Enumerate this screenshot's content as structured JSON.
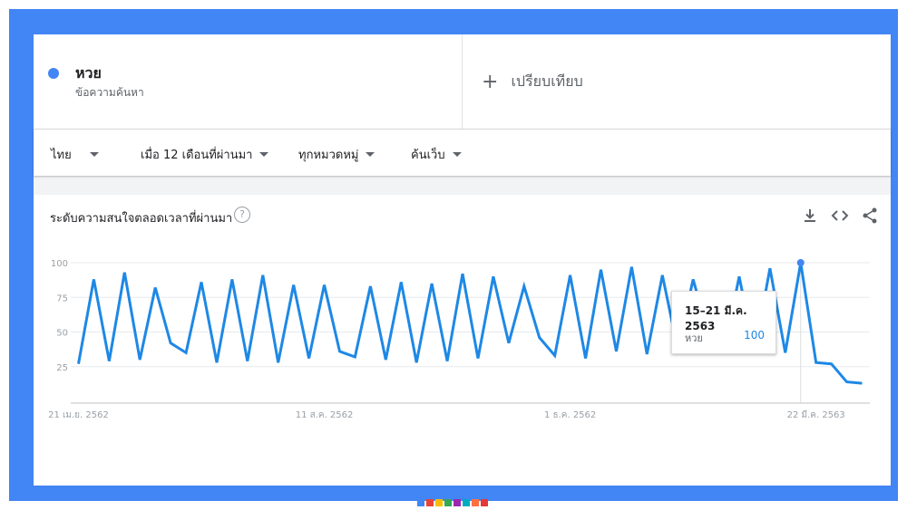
{
  "term": {
    "name": "หวย",
    "subtitle": "ข้อความค้นหา",
    "color": "#4285f4"
  },
  "compare": {
    "label": "เปรียบเทียบ"
  },
  "filters": [
    {
      "label": "ไทย"
    },
    {
      "label": "เมื่อ 12 เดือนที่ผ่านมา"
    },
    {
      "label": "ทุกหมวดหมู่"
    },
    {
      "label": "ค้นเว็บ"
    }
  ],
  "chart_panel": {
    "title": "ระดับความสนใจตลอดเวลาที่ผ่านมา",
    "help": "?",
    "icons": [
      "download-icon",
      "embed-icon",
      "share-icon"
    ]
  },
  "tooltip": {
    "date": "15–21 มี.ค. 2563",
    "term": "หวย",
    "value": "100"
  },
  "chart_data": {
    "type": "line",
    "title": "ระดับความสนใจตลอดเวลาที่ผ่านมา",
    "ylim": [
      0,
      100
    ],
    "yticks": [
      25,
      50,
      75,
      100
    ],
    "xtick_labels": [
      "21 เม.ย. 2562",
      "11 ส.ค. 2562",
      "1 ธ.ค. 2562",
      "22 มี.ค. 2563"
    ],
    "xtick_index": [
      0,
      16,
      32,
      48
    ],
    "grid": true,
    "series": [
      {
        "name": "หวย",
        "color": "#1e88e5",
        "values": [
          27,
          88,
          29,
          93,
          30,
          82,
          42,
          35,
          86,
          28,
          88,
          29,
          91,
          28,
          84,
          31,
          84,
          36,
          32,
          83,
          30,
          86,
          28,
          85,
          29,
          92,
          31,
          90,
          42,
          83,
          46,
          33,
          91,
          31,
          95,
          36,
          97,
          34,
          91,
          38,
          88,
          48,
          36,
          90,
          35,
          96,
          35,
          100,
          28,
          27,
          14,
          13
        ]
      }
    ],
    "highlight_index": 47
  },
  "strip_colors": [
    "#4285f4",
    "#ea4335",
    "#fbbc05",
    "#34a853",
    "#9c27b0",
    "#00acc1",
    "#ff7043",
    "#e53935"
  ]
}
